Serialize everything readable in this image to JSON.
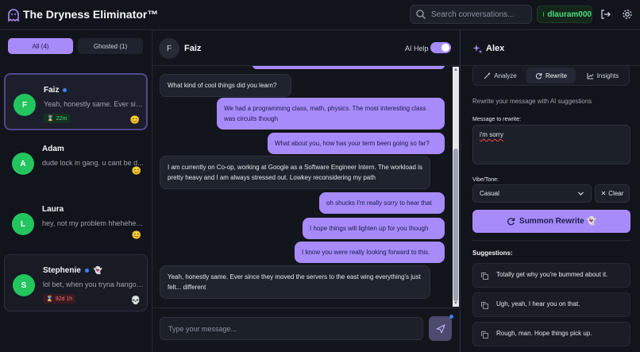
{
  "app": {
    "title": "The Dryness Eliminator™"
  },
  "header": {
    "search_placeholder": "Search conversations...",
    "username": "dlauram000",
    "logout_icon": "logout-icon",
    "settings_icon": "gear-icon"
  },
  "sidebar": {
    "filters": [
      {
        "label": "All (4)",
        "active": true
      },
      {
        "label": "Ghosted (1)",
        "active": false
      }
    ],
    "conversations": [
      {
        "name": "Faiz",
        "initial": "F",
        "preview": "Yeah, honestly same. Ever since...",
        "badge": "22m",
        "badge_color": "green",
        "mood": "😊",
        "unread": true,
        "ghost": ""
      },
      {
        "name": "Adam",
        "initial": "A",
        "preview": "dude lock in gang. u cant be d...",
        "badge": "",
        "mood": "😊",
        "unread": false,
        "ghost": ""
      },
      {
        "name": "Laura",
        "initial": "L",
        "preview": "hey, not my problem hheheheh...",
        "badge": "",
        "mood": "😊",
        "unread": false,
        "ghost": ""
      },
      {
        "name": "Stephenie",
        "initial": "S",
        "preview": "lol bet, when you tryna hangout?",
        "badge": "92d 1h",
        "badge_color": "red",
        "mood": "💀",
        "unread": true,
        "ghost": "👻"
      }
    ]
  },
  "chat": {
    "contact_name": "Faiz",
    "contact_initial": "F",
    "ai_help_label": "AI Help",
    "ai_help_on": true,
    "messages": [
      {
        "dir": "in",
        "text": "What kind of cool things did you learn?"
      },
      {
        "dir": "out",
        "text": "We had a programming class, math, physics. The most interesting class was circuits though"
      },
      {
        "dir": "out",
        "text": "What about you, how has your term been going so far?"
      },
      {
        "dir": "in",
        "text": "I am currently on Co-op, working at Google as a Software Engineer Intern. The workload is pretty heavy and I am always stressed out. Lowkey reconsidering my path"
      },
      {
        "dir": "out",
        "text": "oh shucks I'm really sorry to hear that"
      },
      {
        "dir": "out",
        "text": "I hope things will lighten up for you though"
      },
      {
        "dir": "out",
        "text": "I know you were really looking forward to this."
      },
      {
        "dir": "in",
        "text": "Yeah, honestly same. Ever since they moved the servers to the east wing everything's just felt... different"
      }
    ],
    "composer_placeholder": "Type your message..."
  },
  "panel": {
    "title": "Alex",
    "tabs": [
      {
        "label": "Analyze",
        "icon": "wand-icon"
      },
      {
        "label": "Rewrite",
        "icon": "refresh-icon",
        "active": true
      },
      {
        "label": "Insights",
        "icon": "chart-icon"
      }
    ],
    "description": "Rewrite your message with AI suggestions",
    "message_label": "Message to rewrite:",
    "message_value": "i'm sorry",
    "vibe_label": "Vibe/Tone:",
    "vibe_value": "Casual",
    "clear_label": "Clear",
    "summon_label": "Summon Rewrite 👻",
    "suggestions_title": "Suggestions:",
    "suggestions": [
      "Totally get why you're bummed about it.",
      "Ugh, yeah, I hear you on that.",
      "Rough, man. Hope things pick up."
    ],
    "accent_color": "#a78bfa"
  }
}
